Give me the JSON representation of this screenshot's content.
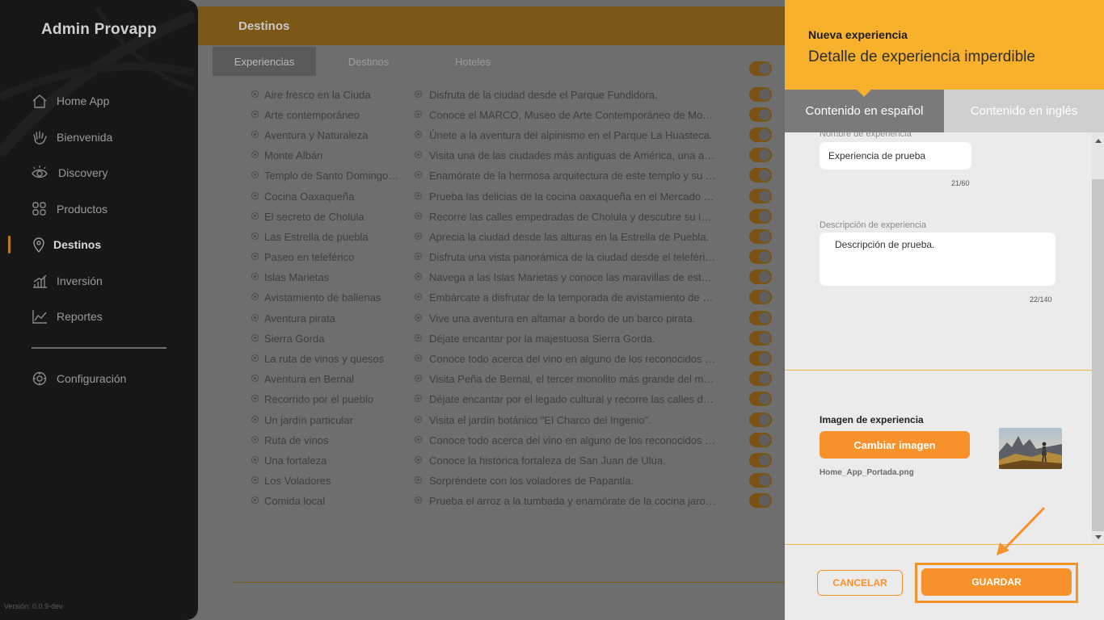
{
  "sidebar": {
    "brand": "Admin Provapp",
    "items": [
      {
        "label": "Home App",
        "icon": "home-icon"
      },
      {
        "label": "Bienvenida",
        "icon": "hand-wave-icon"
      },
      {
        "label": "Discovery",
        "icon": "eye-icon"
      },
      {
        "label": "Productos",
        "icon": "grid-icon"
      },
      {
        "label": "Destinos",
        "icon": "location-pin-icon",
        "active": true
      },
      {
        "label": "Inversión",
        "icon": "bar-chart-icon"
      },
      {
        "label": "Reportes",
        "icon": "line-chart-icon"
      }
    ],
    "settings": {
      "label": "Configuración",
      "icon": "gear-icon"
    },
    "version": "Versión: 0.0.9-dev"
  },
  "main": {
    "title": "Destinos",
    "tabs": [
      "Experiencias",
      "Destinos",
      "Hoteles"
    ],
    "rows": [
      {
        "name": "Aire fresco en la Ciuda",
        "desc": "Disfruta de la ciudad desde el Parque Fundidora."
      },
      {
        "name": "Arte contemporáneo",
        "desc": "Conoce el MARCO, Museo de Arte Contemporáneo de Monterrey."
      },
      {
        "name": "Aventura y Naturaleza",
        "desc": "Únete a la aventura del alpinismo en el Parque La Huasteca."
      },
      {
        "name": "Monte Albán",
        "desc": "Visita una de las ciudades más antiguas de América, una antigua capital zapoteca."
      },
      {
        "name": "Templo de Santo Domingo de Guzmán",
        "desc": "Enamórate de la hermosa arquitectura de este templo y su jardín."
      },
      {
        "name": "Cocina Oaxaqueña",
        "desc": "Prueba las delicias de la cocina oaxaqueña en el Mercado Benito Juárez."
      },
      {
        "name": "El secreto de Cholula",
        "desc": "Recorre las calles empedradas de Cholula y descubre su iglesia."
      },
      {
        "name": "Las Estrella de puebla",
        "desc": "Aprecia la ciudad desde las alturas en la Estrella de Puebla."
      },
      {
        "name": "Paseo en teleférico",
        "desc": "Disfruta una vista panorámica de la ciudad desde el teleférico."
      },
      {
        "name": "Islas Marietas",
        "desc": "Navega a las Islas Marietas y conoce las maravillas de estas islas."
      },
      {
        "name": "Avistamiento de ballenas",
        "desc": "Embárcate a disfrutar de la temporada de avistamiento de ballenas."
      },
      {
        "name": "Aventura pirata",
        "desc": "Vive una aventura en altamar a bordo de un barco pirata."
      },
      {
        "name": "Sierra Gorda",
        "desc": "Déjate encantar por la majestuosa Sierra Gorda."
      },
      {
        "name": "La ruta de vinos y quesos",
        "desc": "Conoce todo acerca del vino en alguno de los reconocidos viñedos."
      },
      {
        "name": "Aventura en Bernal",
        "desc": "Visita Peña de Bernal, el tercer monolito más grande del mundo."
      },
      {
        "name": "Recorrido por el pueblo",
        "desc": "Déjate encantar por el legado cultural y recorre las calles de Bernal."
      },
      {
        "name": "Un jardín particular",
        "desc": "Visita el jardín botánico \"El Charco del Ingenio\"."
      },
      {
        "name": "Ruta de vinos",
        "desc": "Conoce todo acerca del vino en alguno de los reconocidos viñedos."
      },
      {
        "name": "Una fortaleza",
        "desc": "Conoce la histórica fortaleza de San Juan de Ulúa."
      },
      {
        "name": "Los Voladores",
        "desc": "Sorpréndete con los voladores de Papantla."
      },
      {
        "name": "Comida local",
        "desc": "Prueba el arroz a la tumbada y enamórate de la cocina jarocha."
      }
    ]
  },
  "panel": {
    "kicker": "Nueva experiencia",
    "title": "Detalle de experiencia imperdible",
    "tab_es": "Contenido en español",
    "tab_en": "Contenido en inglés",
    "name_label": "Nombre de experiencia",
    "name_value": "Experiencia de prueba",
    "name_counter": "21/60",
    "desc_label": "Descripción de experiencia",
    "desc_value": "Descripción de prueba.",
    "desc_counter": "22/140",
    "image_title": "Imagen de experiencia",
    "change_image": "Cambiar imagen",
    "filename": "Home_App_Portada.png",
    "cancel": "CANCELAR",
    "save": "GUARDAR"
  },
  "colors": {
    "accent": "#f7922a",
    "header_yellow": "#f7b12c",
    "sidebar": "#171717"
  }
}
